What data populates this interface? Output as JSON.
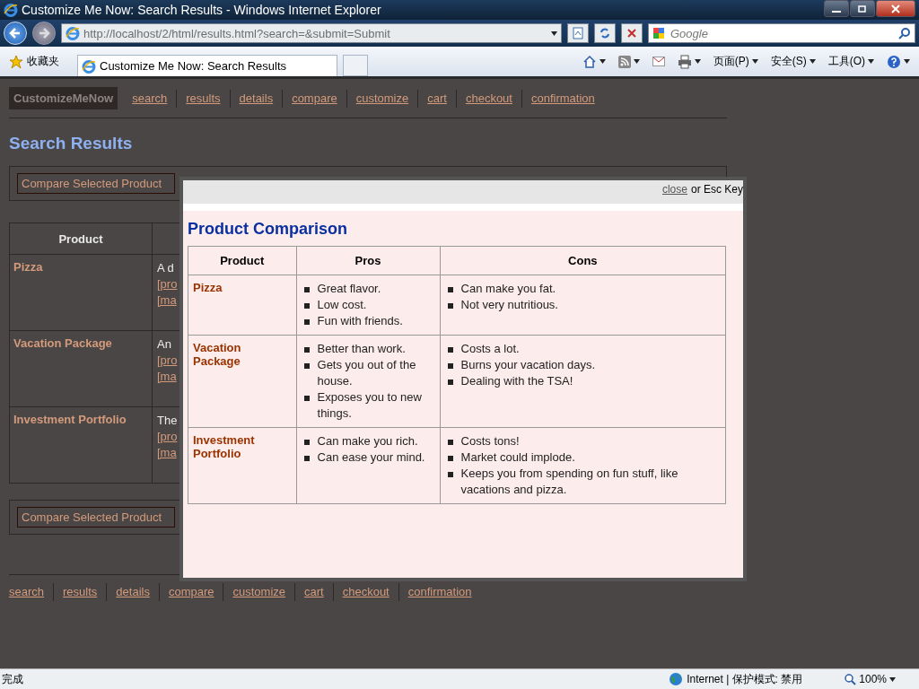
{
  "browser": {
    "title": "Customize Me Now: Search Results - Windows Internet Explorer",
    "address": "http://localhost/2/html/results.html?search=&submit=Submit",
    "search_placeholder": "Google",
    "favorites": "收藏夹",
    "tab_title": "Customize Me Now: Search Results",
    "menus": [
      "页面(P)",
      "安全(S)",
      "工具(O)"
    ],
    "status": "完成",
    "zone": "Internet | 保护模式: 禁用",
    "zoom": "100%"
  },
  "page": {
    "logo": "CustomizeMeNow",
    "nav": [
      "search",
      "results",
      "details",
      "compare",
      "customize",
      "cart",
      "checkout",
      "confirmation"
    ],
    "heading": "Search Results",
    "compare_button_top": "Compare Selected Product",
    "compare_button_bottom": "Compare Selected Product",
    "table": {
      "columns": [
        "Product"
      ],
      "rows": [
        {
          "product": "Pizza",
          "description": "A d",
          "links": [
            "[pro",
            "[ma"
          ]
        },
        {
          "product": "Vacation Package",
          "description": "An",
          "links": [
            "[pro",
            "[ma"
          ]
        },
        {
          "product": "Investment Portfolio",
          "description": "The",
          "links": [
            "[pro",
            "[ma"
          ]
        }
      ]
    },
    "footer_nav": [
      "search",
      "results",
      "details",
      "compare",
      "customize",
      "cart",
      "checkout",
      "confirmation"
    ]
  },
  "modal": {
    "close": "close",
    "close_hint": "or Esc Key",
    "title": "Product Comparison",
    "columns": [
      "Product",
      "Pros",
      "Cons"
    ],
    "rows": [
      {
        "product": "Pizza",
        "pros": [
          "Great flavor.",
          "Low cost.",
          "Fun with friends."
        ],
        "cons": [
          "Can make you fat.",
          "Not very nutritious."
        ]
      },
      {
        "product": "Vacation Package",
        "pros": [
          "Better than work.",
          "Gets you out of the house.",
          "Exposes you to new things."
        ],
        "cons": [
          "Costs a lot.",
          "Burns your vacation days.",
          "Dealing with the TSA!"
        ]
      },
      {
        "product": "Investment Portfolio",
        "pros": [
          "Can make you rich.",
          "Can ease your mind."
        ],
        "cons": [
          "Costs tons!",
          "Market could implode.",
          "Keeps you from spending on fun stuff, like vacations and pizza."
        ]
      }
    ]
  }
}
